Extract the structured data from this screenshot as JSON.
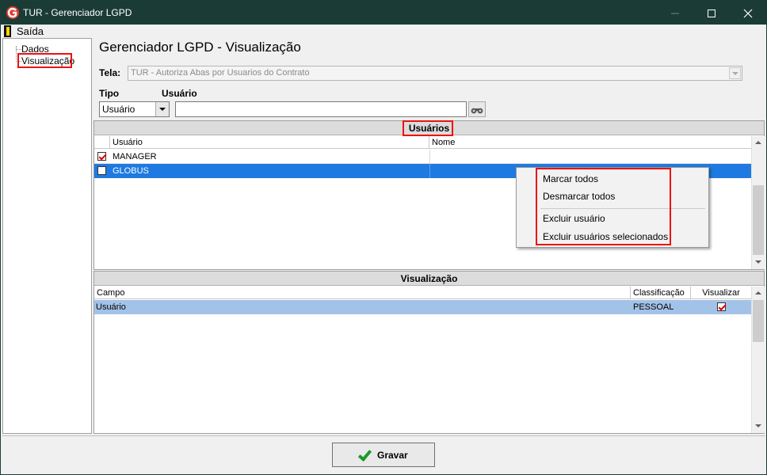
{
  "window": {
    "title": "TUR - Gerenciador LGPD",
    "app_icon": "G"
  },
  "menu": {
    "exit_label": "Saída"
  },
  "tree": {
    "items": [
      "Dados",
      "Visualização"
    ]
  },
  "main": {
    "title": "Gerenciador LGPD - Visualização",
    "tela_label": "Tela:",
    "tela_value": "TUR - Autoriza Abas por Usuarios do Contrato",
    "tipo_label": "Tipo",
    "usuario_label": "Usuário",
    "tipo_value": "Usuário",
    "usuario_value": ""
  },
  "users_panel": {
    "header": "Usuários",
    "columns": [
      "Usuário",
      "Nome"
    ],
    "rows": [
      {
        "usuario": "MANAGER",
        "nome": "",
        "checked": true,
        "selected": false
      },
      {
        "usuario": "GLOBUS",
        "nome": "",
        "checked": false,
        "selected": true
      }
    ]
  },
  "context_menu": {
    "items": [
      "Marcar todos",
      "Desmarcar todos",
      "Excluir usuário",
      "Excluir usuários selecionados"
    ]
  },
  "viz_panel": {
    "header": "Visualização",
    "columns": [
      "Campo",
      "Classificação",
      "Visualizar"
    ],
    "rows": [
      {
        "campo": "Usuário",
        "classificacao": "PESSOAL",
        "visualizar": true
      }
    ]
  },
  "footer": {
    "save_label": "Gravar"
  },
  "colors": {
    "titlebar": "#1b3c36",
    "selection": "#1e7ae0",
    "viz_selection": "#a3c2e8",
    "highlight_box": "#e11111"
  }
}
